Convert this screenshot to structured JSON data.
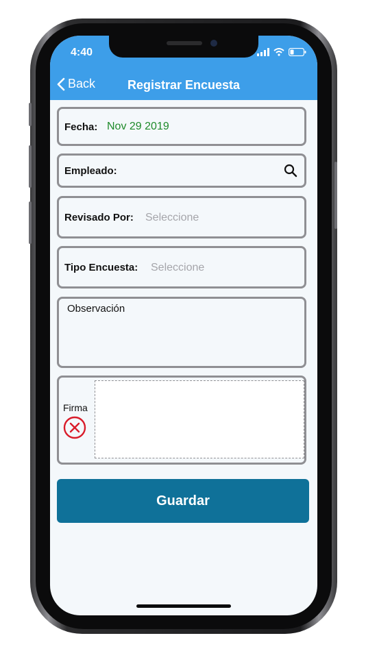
{
  "status_bar": {
    "time": "4:40"
  },
  "nav": {
    "back_label": "Back",
    "title": "Registrar Encuesta"
  },
  "form": {
    "fecha": {
      "label": "Fecha:",
      "value": "Nov 29 2019"
    },
    "empleado": {
      "label": "Empleado:",
      "value": ""
    },
    "revisado_por": {
      "label": "Revisado Por:",
      "placeholder": "Seleccione"
    },
    "tipo_encuesta": {
      "label": "Tipo Encuesta:",
      "placeholder": "Seleccione"
    },
    "observacion": {
      "label": "Observación"
    },
    "firma": {
      "label": "Firma"
    }
  },
  "actions": {
    "save_label": "Guardar"
  },
  "colors": {
    "accent": "#3d9ee9",
    "button": "#0f7199",
    "date_green": "#1e8a2a",
    "clear_red": "#d91c2a"
  },
  "icons": [
    "back-chevron-icon",
    "search-icon",
    "clear-x-icon",
    "signal-icon",
    "wifi-icon",
    "battery-icon"
  ]
}
